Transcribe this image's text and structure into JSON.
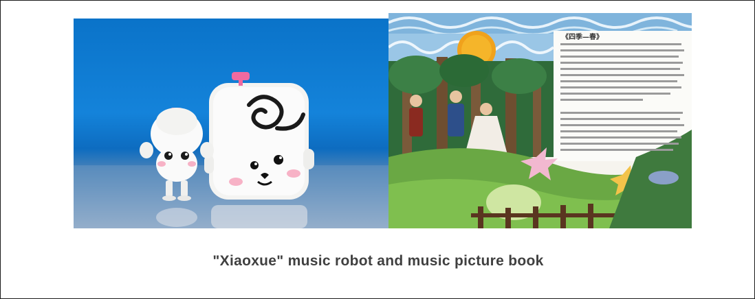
{
  "caption": "\"Xiaoxue\" music robot and music picture book",
  "book": {
    "page_title": "《四季—春》"
  }
}
